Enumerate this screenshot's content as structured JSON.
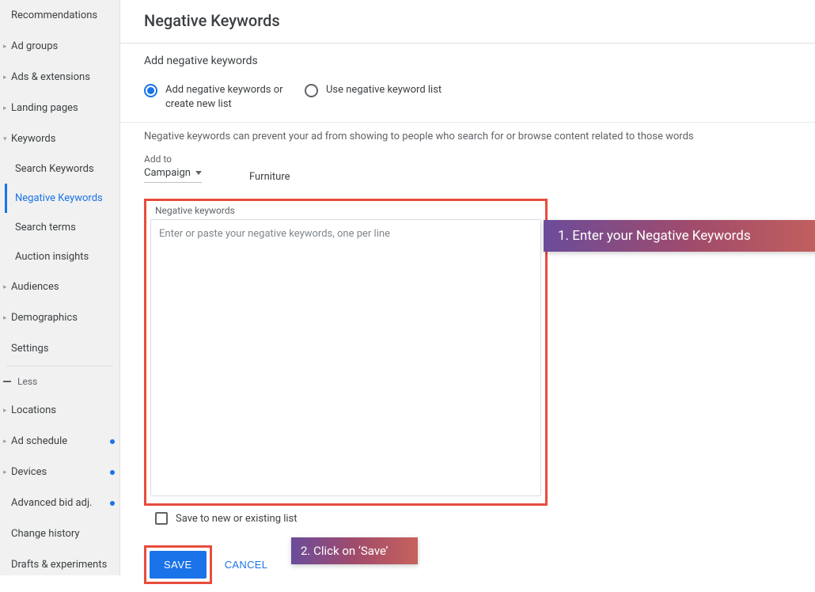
{
  "sidebar": {
    "items": [
      {
        "label": "Recommendations",
        "chev": false,
        "dot": false
      },
      {
        "label": "Ad groups",
        "chev": true,
        "dot": false
      },
      {
        "label": "Ads & extensions",
        "chev": true,
        "dot": false
      },
      {
        "label": "Landing pages",
        "chev": true,
        "dot": false
      }
    ],
    "keywords_label": "Keywords",
    "keywords_sub": [
      {
        "label": "Search Keywords",
        "active": false
      },
      {
        "label": "Negative Keywords",
        "active": true
      },
      {
        "label": "Search terms",
        "active": false
      },
      {
        "label": "Auction insights",
        "active": false
      }
    ],
    "after_items": [
      {
        "label": "Audiences",
        "chev": true,
        "dot": false
      },
      {
        "label": "Demographics",
        "chev": true,
        "dot": false
      },
      {
        "label": "Settings",
        "chev": false,
        "dot": false
      }
    ],
    "less_label": "Less",
    "bottom_items": [
      {
        "label": "Locations",
        "chev": true,
        "dot": false
      },
      {
        "label": "Ad schedule",
        "chev": true,
        "dot": true
      },
      {
        "label": "Devices",
        "chev": true,
        "dot": true
      },
      {
        "label": "Advanced bid adj.",
        "chev": false,
        "dot": true
      },
      {
        "label": "Change history",
        "chev": false,
        "dot": false
      },
      {
        "label": "Drafts & experiments",
        "chev": false,
        "dot": false
      }
    ]
  },
  "main": {
    "title": "Negative Keywords",
    "subtitle": "Add negative keywords",
    "radio1": "Add negative keywords or create new list",
    "radio2": "Use negative keyword list",
    "helper": "Negative keywords can prevent your ad from showing to people who search for or browse content related to those words",
    "addto_label": "Add to",
    "addto_value": "Campaign",
    "campaign_name": "Furniture",
    "neg_label": "Negative keywords",
    "neg_placeholder": "Enter or paste your negative keywords, one per line",
    "save_list_label": "Save to new or existing list",
    "save_button": "SAVE",
    "cancel_button": "CANCEL"
  },
  "annotations": {
    "callout1": "1.   Enter your Negative Keywords",
    "callout2": "2. Click on ‘Save’"
  }
}
